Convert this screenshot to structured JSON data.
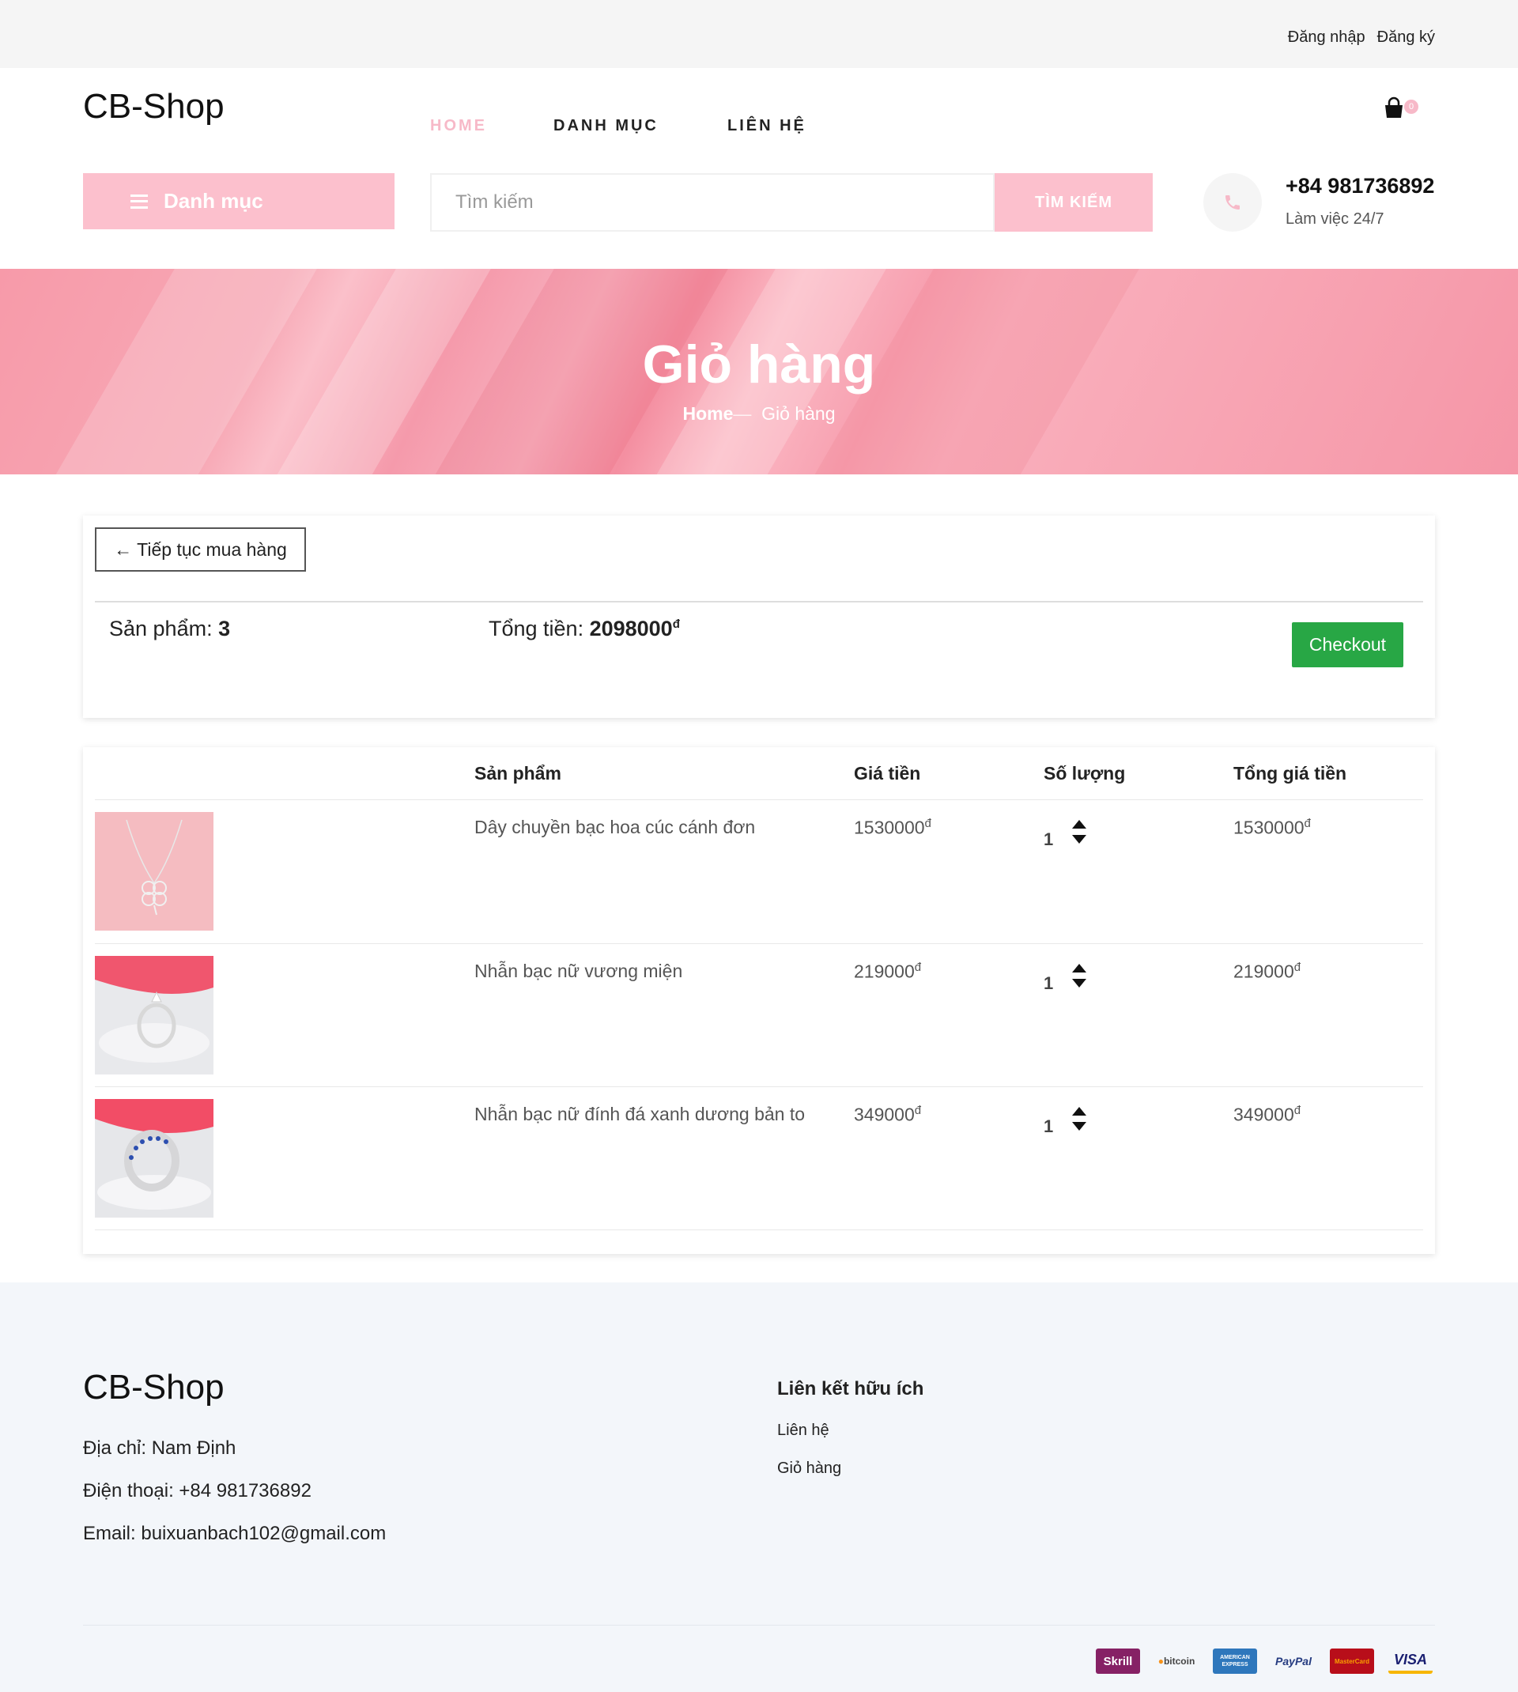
{
  "topbar": {
    "login": "Đăng nhập",
    "register": "Đăng ký"
  },
  "header": {
    "logo": "CB-Shop",
    "nav": [
      {
        "label": "HOME",
        "active": true
      },
      {
        "label": "DANH MỤC",
        "active": false
      },
      {
        "label": "LIÊN HỆ",
        "active": false
      }
    ],
    "cart_count": "0",
    "category_button": "Danh mục",
    "search": {
      "placeholder": "Tìm kiếm",
      "value": "",
      "button": "TÌM KIẾM"
    },
    "phone": {
      "number": "+84 981736892",
      "note": "Làm việc 24/7"
    }
  },
  "banner": {
    "title": "Giỏ hàng",
    "breadcrumb": {
      "home": "Home",
      "separator": "—",
      "current": "Giỏ hàng"
    }
  },
  "summary": {
    "continue_button": "← Tiếp tục mua hàng",
    "count_label": "Sản phẩm: ",
    "count_value": "3",
    "total_label": "Tổng tiền: ",
    "total_value": "2098000",
    "currency": "đ",
    "checkout_button": "Checkout"
  },
  "cart_table": {
    "headers": [
      "Sản phẩm",
      "Giá tiền",
      "Số lượng",
      "Tổng giá tiền"
    ],
    "rows": [
      {
        "name": "Dây chuyền bạc hoa cúc cánh đơn",
        "price": "1530000",
        "qty": "1",
        "total": "1530000"
      },
      {
        "name": "Nhẫn bạc nữ vương miện",
        "price": "219000",
        "qty": "1",
        "total": "219000"
      },
      {
        "name": "Nhẫn bạc nữ đính đá xanh dương bản to",
        "price": "349000",
        "qty": "1",
        "total": "349000"
      }
    ]
  },
  "footer": {
    "logo": "CB-Shop",
    "address": "Địa chỉ: Nam Định",
    "phone": "Điện thoại: +84 981736892",
    "email": "Email: buixuanbach102@gmail.com",
    "links_title": "Liên kết hữu ích",
    "links": [
      "Liên hệ",
      "Giỏ hàng"
    ],
    "payments": [
      "Skrill",
      "bitcoin",
      "AMERICAN EXPRESS",
      "PayPal",
      "MasterCard",
      "VISA"
    ]
  },
  "colors": {
    "accent_pink": "#fcc0cd",
    "checkout_green": "#28a745",
    "banner_pink": "#f79aa9"
  }
}
